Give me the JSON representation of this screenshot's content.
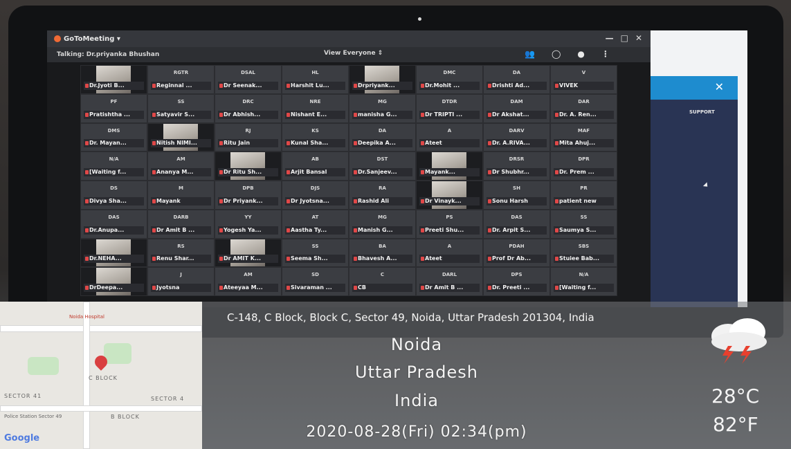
{
  "meeting": {
    "app_name": "GoToMeeting ▾",
    "talking": "Talking: Dr.priyanka Bhushan",
    "view": "View Everyone ⇕",
    "icons": [
      "people-icon",
      "chat-icon",
      "smiley-icon",
      "more-icon"
    ]
  },
  "tiles": [
    {
      "ini": "",
      "name": "Dr.Jyoti B...",
      "video": true
    },
    {
      "ini": "RGTR",
      "name": "Reginnal ...",
      "video": false
    },
    {
      "ini": "DSAL",
      "name": "Dr Seenak...",
      "video": false
    },
    {
      "ini": "HL",
      "name": "Harshit Lu...",
      "video": false
    },
    {
      "ini": "",
      "name": "Drpriyank...",
      "video": true
    },
    {
      "ini": "DMC",
      "name": "Dr.Mohit ...",
      "video": false
    },
    {
      "ini": "DA",
      "name": "Drishti Ad...",
      "video": false
    },
    {
      "ini": "V",
      "name": "VIVEK",
      "video": false
    },
    {
      "ini": "PF",
      "name": "Pratishtha ...",
      "video": false
    },
    {
      "ini": "SS",
      "name": "Satyavir S...",
      "video": false
    },
    {
      "ini": "DRC",
      "name": "Dr Abhish...",
      "video": false
    },
    {
      "ini": "NRE",
      "name": "Nishant E...",
      "video": false
    },
    {
      "ini": "MG",
      "name": "manisha G...",
      "video": false
    },
    {
      "ini": "DTDR",
      "name": "Dr TRIPTI ...",
      "video": false
    },
    {
      "ini": "DAM",
      "name": "Dr Akshat...",
      "video": false
    },
    {
      "ini": "DAR",
      "name": "Dr. A. Ren...",
      "video": false
    },
    {
      "ini": "DMS",
      "name": "Dr. Mayan...",
      "video": false
    },
    {
      "ini": "",
      "name": "Nitish NIMI...",
      "video": true
    },
    {
      "ini": "RJ",
      "name": "Ritu Jain",
      "video": false
    },
    {
      "ini": "KS",
      "name": "Kunal Sha...",
      "video": false
    },
    {
      "ini": "DA",
      "name": "Deepika A...",
      "video": false
    },
    {
      "ini": "A",
      "name": "Ateet",
      "video": false
    },
    {
      "ini": "DARV",
      "name": "Dr. A.RIVA...",
      "video": false
    },
    {
      "ini": "MAF",
      "name": "Mita Ahuj...",
      "video": false
    },
    {
      "ini": "N/A",
      "name": "[Waiting f...",
      "video": false
    },
    {
      "ini": "AM",
      "name": "Ananya M...",
      "video": false
    },
    {
      "ini": "",
      "name": "Dr Ritu Sh...",
      "video": true
    },
    {
      "ini": "AB",
      "name": "Arjit Bansal",
      "video": false
    },
    {
      "ini": "DST",
      "name": "Dr.Sanjeev...",
      "video": false
    },
    {
      "ini": "",
      "name": "Mayank...",
      "video": true
    },
    {
      "ini": "DRSR",
      "name": "Dr Shubhr...",
      "video": false
    },
    {
      "ini": "DPR",
      "name": "Dr. Prem ...",
      "video": false
    },
    {
      "ini": "DS",
      "name": "Divya Sha...",
      "video": false
    },
    {
      "ini": "M",
      "name": "Mayank",
      "video": false
    },
    {
      "ini": "DPB",
      "name": "Dr Priyank...",
      "video": false
    },
    {
      "ini": "DJS",
      "name": "Dr Jyotsna...",
      "video": false
    },
    {
      "ini": "RA",
      "name": "Rashid Ali",
      "video": false
    },
    {
      "ini": "",
      "name": "Dr Vinayk...",
      "video": true
    },
    {
      "ini": "SH",
      "name": "Sonu Harsh",
      "video": false
    },
    {
      "ini": "PR",
      "name": "patient new",
      "video": false
    },
    {
      "ini": "DAS",
      "name": "Dr.Anupa...",
      "video": false
    },
    {
      "ini": "DARB",
      "name": "Dr Amit B ...",
      "video": false
    },
    {
      "ini": "YY",
      "name": "Yogesh Ya...",
      "video": false
    },
    {
      "ini": "AT",
      "name": "Aastha Ty...",
      "video": false
    },
    {
      "ini": "MG",
      "name": "Manish G...",
      "video": false
    },
    {
      "ini": "PS",
      "name": "Preeti Shu...",
      "video": false
    },
    {
      "ini": "DAS",
      "name": "Dr. Arpit S...",
      "video": false
    },
    {
      "ini": "SS",
      "name": "Saumya S...",
      "video": false
    },
    {
      "ini": "",
      "name": "Dr.NEHA...",
      "video": true
    },
    {
      "ini": "RS",
      "name": "Renu Shar...",
      "video": false
    },
    {
      "ini": "",
      "name": "Dr AMIT K...",
      "video": true
    },
    {
      "ini": "SS",
      "name": "Seema Sh...",
      "video": false
    },
    {
      "ini": "BA",
      "name": "Bhavesh A...",
      "video": false
    },
    {
      "ini": "A",
      "name": "Ateet",
      "video": false
    },
    {
      "ini": "PDAH",
      "name": "Prof Dr Ab...",
      "video": false
    },
    {
      "ini": "SBS",
      "name": "Stuiee Bab...",
      "video": false
    },
    {
      "ini": "",
      "name": "DrDeepa...",
      "video": true
    },
    {
      "ini": "J",
      "name": "Jyotsna",
      "video": false
    },
    {
      "ini": "AM",
      "name": "Ateeyaa M...",
      "video": false
    },
    {
      "ini": "SD",
      "name": "Sivaraman ...",
      "video": false
    },
    {
      "ini": "C",
      "name": "CB",
      "video": false
    },
    {
      "ini": "DARL",
      "name": "Dr Amit B ...",
      "video": false
    },
    {
      "ini": "DPS",
      "name": "Dr. Preeti ...",
      "video": false
    },
    {
      "ini": "N/A",
      "name": "[Waiting f...",
      "video": false
    }
  ],
  "side_panel": {
    "close": "✕",
    "support": "SUPPORT"
  },
  "overlay": {
    "address": "C-148, C Block, Block C, Sector 49, Noida, Uttar Pradesh 201304, India",
    "city": "Noida",
    "state": "Uttar Pradesh",
    "country": "India",
    "datetime": "2020-08-28(Fri)   02:34(pm)",
    "temp_c": "28°C",
    "temp_f": "82°F",
    "weather": "thunderstorm-icon"
  },
  "map": {
    "labels": [
      "C BLOCK",
      "SECTOR 41",
      "SECTOR 4",
      "B BLOCK",
      "Police Station Sector 49",
      "Noida Hospital"
    ],
    "logo": "Google"
  }
}
